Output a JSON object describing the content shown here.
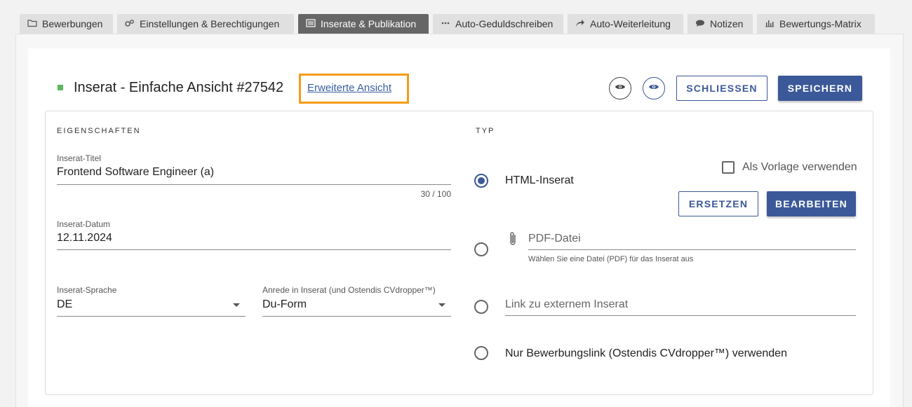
{
  "tabs": [
    {
      "label": "Bewerbungen",
      "icon": "folder-icon"
    },
    {
      "label": "Einstellungen & Berechtigungen",
      "icon": "gears-icon"
    },
    {
      "label": "Inserate & Publikation",
      "icon": "list-icon",
      "active": true
    },
    {
      "label": "Auto-Geduldschreiben",
      "icon": "dots-icon"
    },
    {
      "label": "Auto-Weiterleitung",
      "icon": "share-arrow-icon"
    },
    {
      "label": "Notizen",
      "icon": "comment-icon"
    },
    {
      "label": "Bewertungs-Matrix",
      "icon": "bar-chart-icon"
    }
  ],
  "header": {
    "title": "Inserat - Einfache Ansicht #27542",
    "advanced_link": "Erweiterte Ansicht",
    "close_label": "SCHLIESSEN",
    "save_label": "SPEICHERN",
    "status_color": "#5cb85c"
  },
  "properties": {
    "heading": "EIGENSCHAFTEN",
    "title_label": "Inserat-Titel",
    "title_value": "Frontend Software Engineer (a)",
    "title_counter": "30 / 100",
    "date_label": "Inserat-Datum",
    "date_value": "12.11.2024",
    "language_label": "Inserat-Sprache",
    "language_value": "DE",
    "salutation_label": "Anrede in Inserat (und Ostendis CVdropper™)",
    "salutation_value": "Du-Form"
  },
  "type": {
    "heading": "TYP",
    "template_label": "Als Vorlage verwenden",
    "template_checked": false,
    "html_label": "HTML-Inserat",
    "replace_label": "ERSETZEN",
    "edit_label": "BEARBEITEN",
    "pdf_placeholder": "PDF-Datei",
    "pdf_hint": "Wählen Sie eine Datei (PDF) für das Inserat aus",
    "link_placeholder": "Link zu externem Inserat",
    "link_only_label": "Nur Bewerbungslink (Ostendis CVdropper™) verwenden",
    "selected": "html"
  },
  "colors": {
    "accent": "#3b5998",
    "highlight": "#f59c1a"
  }
}
